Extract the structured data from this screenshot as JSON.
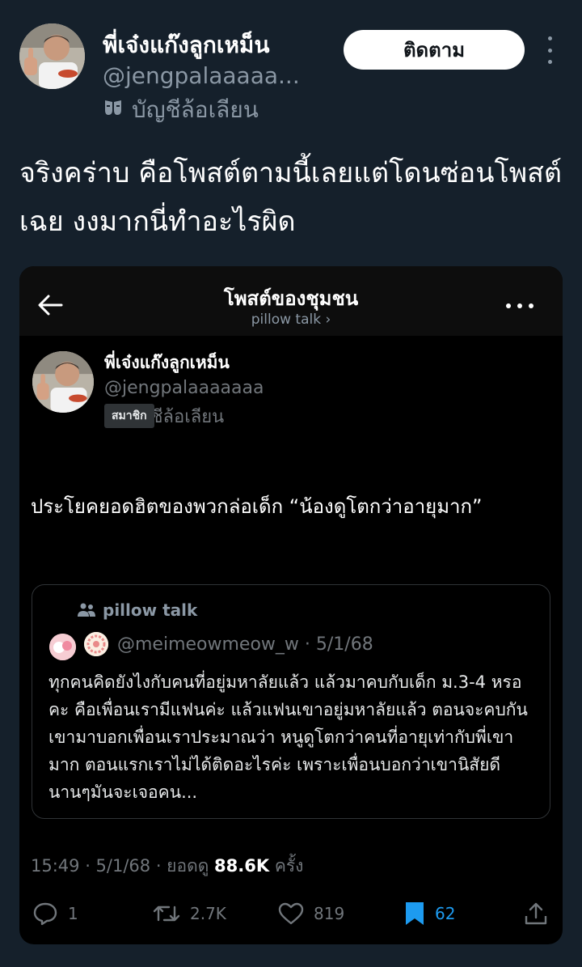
{
  "post": {
    "display_name": "พี่เจ๋งแก๊งลูกเหม็น",
    "handle": "@jengpalaaaaa...",
    "anon_label": "บัญชีล้อเลียน",
    "follow_label": "ติดตาม",
    "text": "จริงคร่าบ คือโพสต์ตามนี้เลยแต่โดนซ่อนโพสต์เฉย งงมากนี่ทำอะไรผิด"
  },
  "embedded": {
    "header_title": "โพสต์ของชุมชน",
    "header_subtitle": "pillow talk ›",
    "display_name": "พี่เจ๋งแก๊งลูกเหม็น",
    "handle": "@jengpalaaaaaaa",
    "member_badge": "สมาชิก",
    "member_suffix": "ชีล้อเลียน",
    "text": "ประโยคยอดฮิตของพวกล่อเด็ก “น้องดูโตกว่าอายุมาก”",
    "quote": {
      "community": "pillow talk",
      "handle_date": "@meimeowmeow_w · 5/1/68",
      "text": "ทุกคนคิดยังไงกับคนที่อยู่มหาลัยแล้ว แล้วมาคบกับเด็ก ม.3-4 หรอคะ คือเพื่อนเรามีแฟนค่ะ แล้วแฟนเขาอยู่มหาลัยแล้ว ตอนจะคบกันเขามาบอกเพื่อนเราประมาณว่า หนูดูโตกว่าคนที่อายุเท่ากับพี่เขามาก ตอนแรกเราไม่ได้ติดอะไรค่ะ เพราะเพื่อนบอกว่าเขานิสัยดี นานๆมันจะเจอคน..."
    },
    "meta_prefix": "15:49 · 5/1/68 · ยอดดู ",
    "meta_views": "88.6K",
    "meta_suffix": " ครั้ง",
    "actions": {
      "replies": "1",
      "reposts": "2.7K",
      "likes": "819",
      "bookmarks": "62"
    }
  },
  "colors": {
    "background": "#15202b",
    "card": "#000000",
    "accent": "#1d9bf0",
    "muted": "#8b98a5"
  },
  "icons": [
    "more-vertical-icon",
    "mask-icon",
    "back-arrow-icon",
    "more-horizontal-icon",
    "community-icon",
    "reply-icon",
    "repost-icon",
    "like-icon",
    "bookmark-icon",
    "share-icon"
  ]
}
